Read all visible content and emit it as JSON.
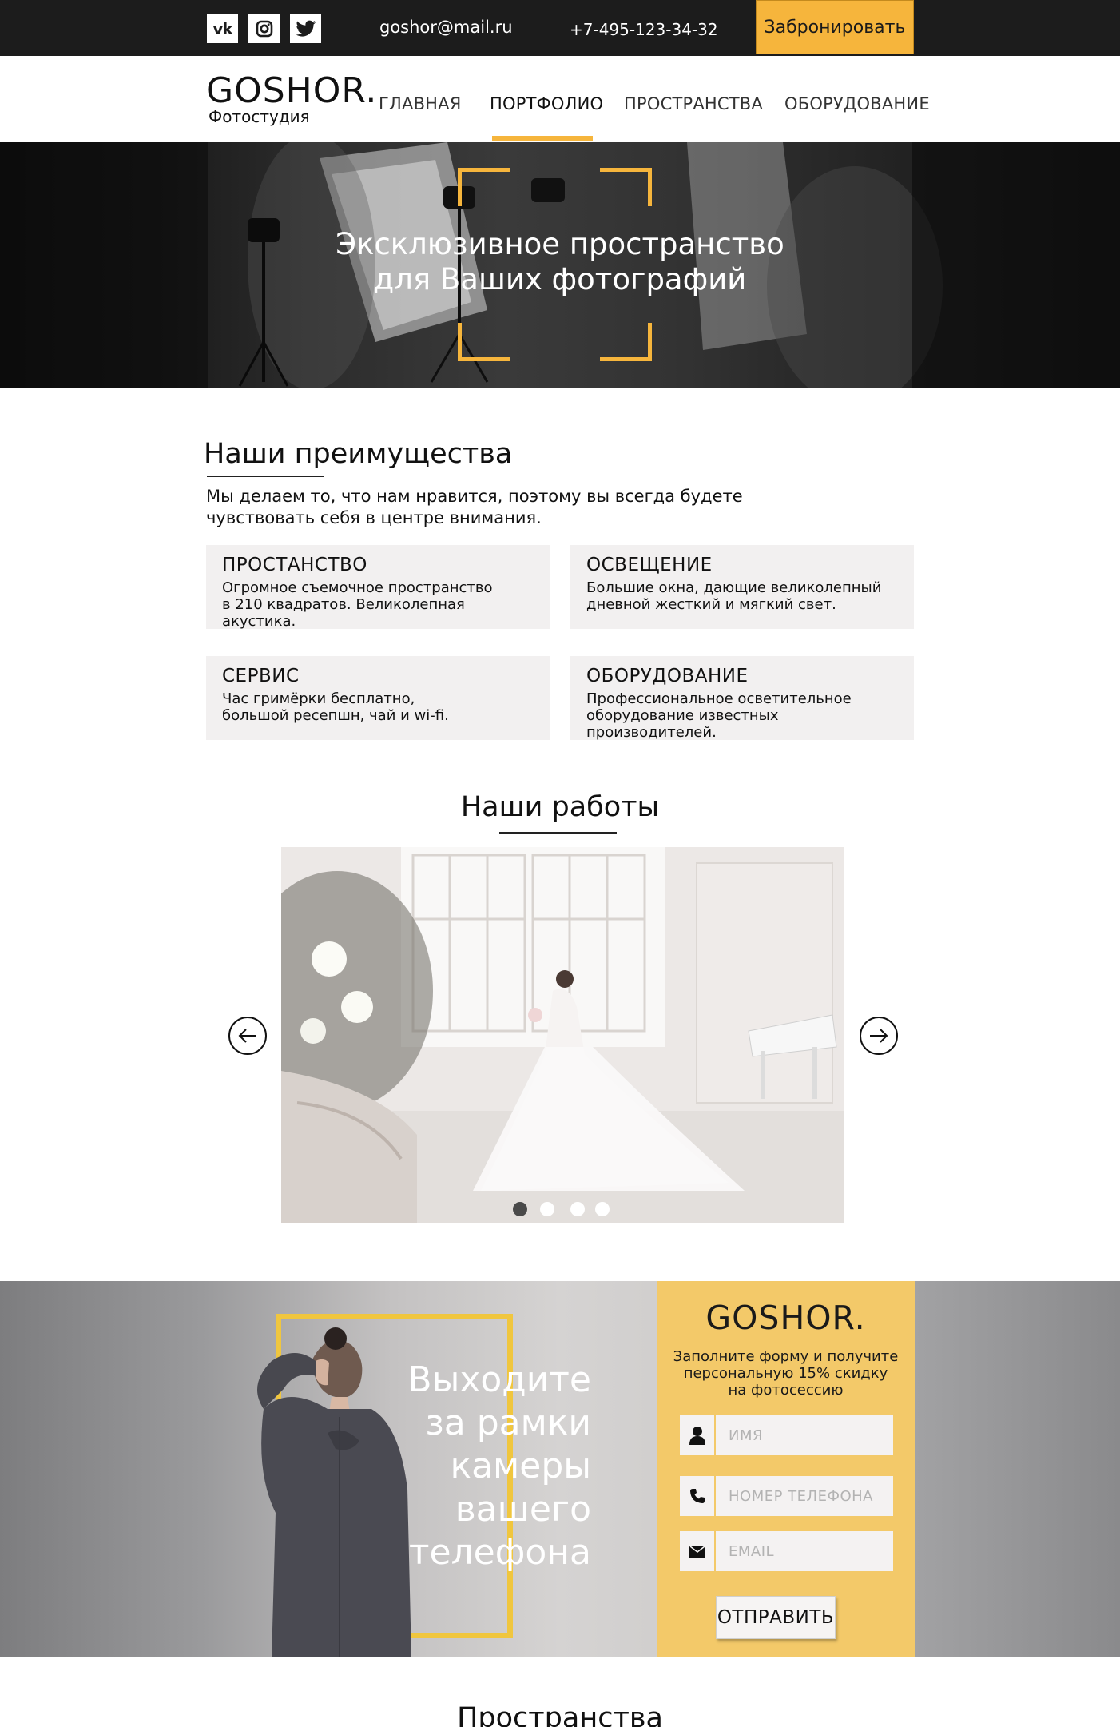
{
  "topbar": {
    "social": [
      {
        "name": "vk-icon",
        "glyph": "vk"
      },
      {
        "name": "instagram-icon"
      },
      {
        "name": "twitter-icon"
      }
    ],
    "email": "goshor@mail.ru",
    "phone": "+7-495-123-34-32",
    "book_label": "Забронировать",
    "accent_color": "#f6b53c"
  },
  "nav": {
    "logo_main": "GOSHOR.",
    "logo_sub": "Фотостудия",
    "links": [
      "ГЛАВНАЯ",
      "ПОРТФОЛИО",
      "ПРОСТРАНСТВА",
      "ОБОРУДОВАНИЕ"
    ],
    "active": "ПОРТФОЛИО"
  },
  "hero": {
    "title_line1": "Эксклюзивное пространство",
    "title_line2": "для Ваших фотографий"
  },
  "advantages": {
    "title": "Наши преимущества",
    "desc_line1": "Мы делаем то, что нам нравится, поэтому вы всегда будете",
    "desc_line2": "чувствовать себя в центре внимания.",
    "cards": [
      {
        "title": "ПРОСТАНСТВО",
        "line1": "Огромное съемочное пространство",
        "line2": "в 210 квадратов. Великолепная акустика."
      },
      {
        "title": "ОСВЕЩЕНИЕ",
        "line1": "Большие окна, дающие великолепный",
        "line2": "дневной жесткий и мягкий свет."
      },
      {
        "title": "СЕРВИС",
        "line1": "Час гримёрки бесплатно,",
        "line2": "большой ресепшн, чай и wi-fi."
      },
      {
        "title": "ОБОРУДОВАНИЕ",
        "line1": "Профессиональное осветительное",
        "line2": "оборудование известных производителей."
      }
    ]
  },
  "works": {
    "title": "Наши работы",
    "slide_count": 4,
    "active_slide": 1
  },
  "promo": {
    "line1": "Выходите",
    "line2": "за рамки",
    "line3": "камеры",
    "line4": "вашего",
    "line5": "телефона",
    "frame_color": "#f0c63e",
    "form": {
      "logo": "GOSHOR.",
      "desc_line1": "Заполните форму и получите",
      "desc_line2": "персональную 15% скидку",
      "desc_line3": "на фотосессию",
      "name_placeholder": "ИМЯ",
      "phone_placeholder": "НОМЕР ТЕЛЕФОНА",
      "email_placeholder": "EMAIL",
      "submit_label": "ОТПРАВИТЬ",
      "panel_color": "#f3c969"
    }
  },
  "spaces": {
    "title": "Пространства"
  }
}
